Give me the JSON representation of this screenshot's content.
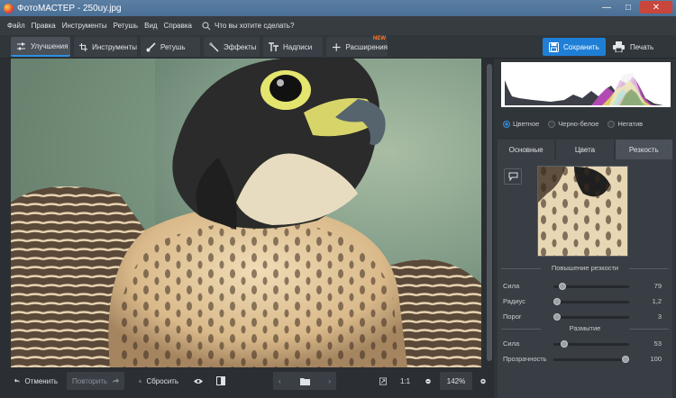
{
  "title": "ФотоМАСТЕР - 250uy.jpg",
  "menu": {
    "items": [
      "Файл",
      "Правка",
      "Инструменты",
      "Ретушь",
      "Вид",
      "Справка"
    ],
    "search_placeholder": "Что вы хотите сделать?"
  },
  "toolbar": {
    "tabs": [
      {
        "label": "Улучшения",
        "icon": "sliders-icon"
      },
      {
        "label": "Инструменты",
        "icon": "crop-icon"
      },
      {
        "label": "Ретушь",
        "icon": "brush-icon"
      },
      {
        "label": "Эффекты",
        "icon": "magic-wand-icon"
      },
      {
        "label": "Надписи",
        "icon": "text-icon"
      },
      {
        "label": "Расширения",
        "icon": "plus-icon"
      }
    ],
    "new_badge": "NEW",
    "save_label": "Сохранить",
    "print_label": "Печать"
  },
  "bottom": {
    "undo": "Отменить",
    "redo": "Повторить",
    "reset": "Сбросить",
    "ratio": "1:1",
    "zoom": "142%"
  },
  "panel": {
    "modes": [
      "Цветное",
      "Черно-белое",
      "Негатив"
    ],
    "selected_mode": "Цветное",
    "tabs": [
      "Основные",
      "Цвета",
      "Резкость"
    ],
    "active_tab": "Резкость",
    "sharpen": {
      "title": "Повышение резкости",
      "sliders": [
        {
          "label": "Сила",
          "value": "79",
          "fraction": 0.08
        },
        {
          "label": "Радиус",
          "value": "1,2",
          "fraction": 0.0
        },
        {
          "label": "Порог",
          "value": "3",
          "fraction": 0.0
        }
      ]
    },
    "blur": {
      "title": "Размытие",
      "sliders": [
        {
          "label": "Сила",
          "value": "53",
          "fraction": 0.1
        },
        {
          "label": "Прозрачность",
          "value": "100",
          "fraction": 1.0
        }
      ]
    }
  },
  "colors": {
    "accent": "#1f7fd6",
    "new_badge": "#ff7a2e",
    "close": "#c9463d"
  }
}
